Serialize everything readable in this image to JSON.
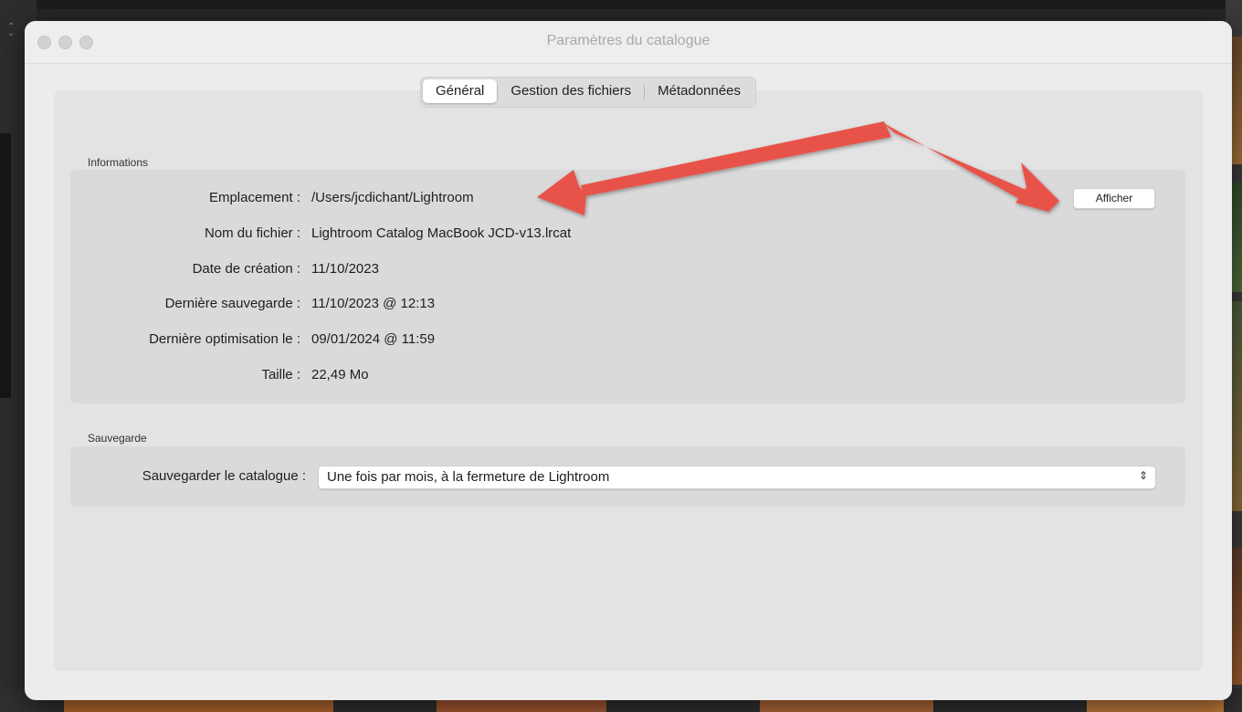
{
  "window": {
    "title": "Paramètres du catalogue"
  },
  "tabs": [
    {
      "label": "Général",
      "active": true
    },
    {
      "label": "Gestion des fichiers",
      "active": false
    },
    {
      "label": "Métadonnées",
      "active": false
    }
  ],
  "informations": {
    "section_label": "Informations",
    "rows": [
      {
        "label": "Emplacement :",
        "value": "/Users/jcdichant/Lightroom"
      },
      {
        "label": "Nom du fichier :",
        "value": "Lightroom Catalog MacBook JCD-v13.lrcat"
      },
      {
        "label": "Date de création :",
        "value": "11/10/2023"
      },
      {
        "label": "Dernière sauvegarde :",
        "value": "11/10/2023 @ 12:13"
      },
      {
        "label": "Dernière optimisation le :",
        "value": "09/01/2024 @ 11:59"
      },
      {
        "label": "Taille :",
        "value": "22,49 Mo"
      }
    ],
    "show_button": "Afficher"
  },
  "sauvegarde": {
    "section_label": "Sauvegarde",
    "field_label": "Sauvegarder le catalogue :",
    "selected_value": "Une fois par mois, à la fermeture de Lightroom"
  },
  "annotation": {
    "arrow_color": "#e8534a"
  },
  "icons": {
    "select_chevron": "updown-chevron-icon"
  }
}
